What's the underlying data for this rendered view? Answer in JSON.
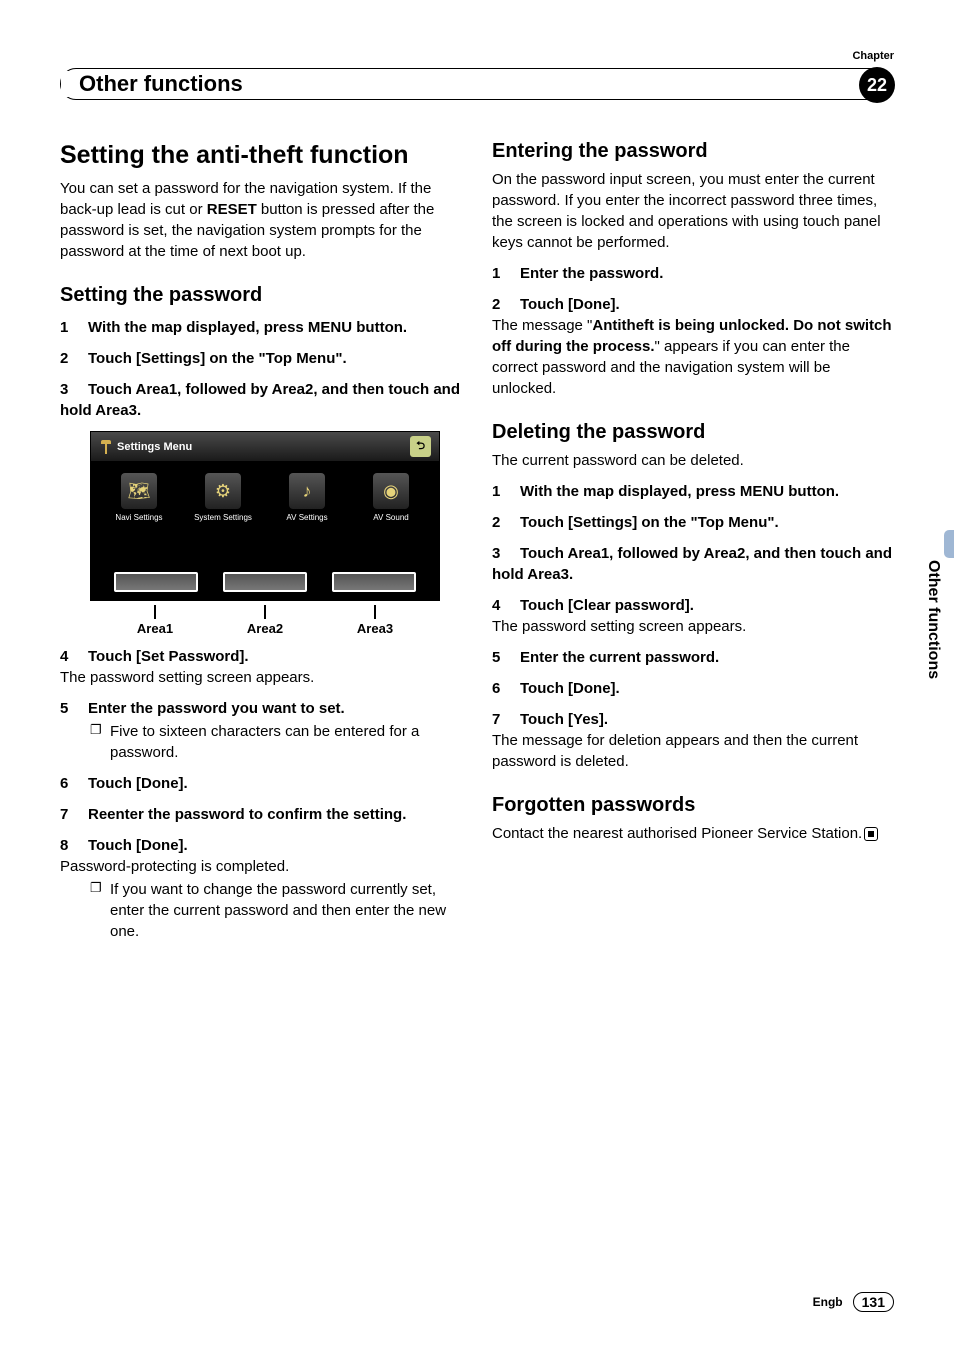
{
  "header": {
    "chapter_label": "Chapter",
    "title": "Other functions",
    "chapter_num": "22"
  },
  "side_tab": "Other functions",
  "footer": {
    "lang": "Engb",
    "page": "131"
  },
  "left": {
    "h1": "Setting the anti-theft function",
    "intro_pre": "You can set a password for the navigation system. If the back-up lead is cut or ",
    "intro_reset": "RESET",
    "intro_post": " button is pressed after the password is set, the navigation system prompts for the password at the time of next boot up.",
    "h2a": "Setting the password",
    "s1": {
      "n": "1",
      "t": "With the map displayed, press MENU button."
    },
    "s2": {
      "n": "2",
      "t": "Touch [Settings] on the \"Top Menu\"."
    },
    "s3": {
      "n": "3",
      "t": "Touch Area1, followed by Area2, and then touch and hold Area3."
    },
    "screen": {
      "title": "Settings Menu",
      "icons": [
        "Navi Settings",
        "System Settings",
        "AV Settings",
        "AV Sound"
      ],
      "areas": [
        "Area1",
        "Area2",
        "Area3"
      ]
    },
    "s4": {
      "n": "4",
      "t": "Touch [Set Password].",
      "f": "The password setting screen appears."
    },
    "s5": {
      "n": "5",
      "t": "Enter the password you want to set.",
      "b": "Five to sixteen characters can be entered for a password."
    },
    "s6": {
      "n": "6",
      "t": "Touch [Done]."
    },
    "s7": {
      "n": "7",
      "t": "Reenter the password to confirm the setting."
    },
    "s8": {
      "n": "8",
      "t": "Touch [Done].",
      "f": "Password-protecting is completed.",
      "b": "If you want to change the password currently set, enter the current password and then enter the new one."
    }
  },
  "right": {
    "h2a": "Entering the password",
    "p1": "On the password input screen, you must enter the current password. If you enter the incorrect password three times, the screen is locked and operations with using touch panel keys cannot be performed.",
    "e1": {
      "n": "1",
      "t": "Enter the password."
    },
    "e2": {
      "n": "2",
      "t": "Touch [Done]."
    },
    "e2_msg_pre": "The message \"",
    "e2_msg_bold": "Antitheft is being unlocked. Do not switch off during the process.",
    "e2_msg_post": "\" appears if you can enter the correct password and the navigation system will be unlocked.",
    "h2b": "Deleting the password",
    "p2": "The current password can be deleted.",
    "d1": {
      "n": "1",
      "t": "With the map displayed, press MENU button."
    },
    "d2": {
      "n": "2",
      "t": "Touch [Settings] on the \"Top Menu\"."
    },
    "d3": {
      "n": "3",
      "t": "Touch Area1, followed by Area2, and then touch and hold Area3."
    },
    "d4": {
      "n": "4",
      "t": "Touch [Clear password].",
      "f": "The password setting screen appears."
    },
    "d5": {
      "n": "5",
      "t": "Enter the current password."
    },
    "d6": {
      "n": "6",
      "t": "Touch [Done]."
    },
    "d7": {
      "n": "7",
      "t": "Touch [Yes].",
      "f": "The message for deletion appears and then the current password is deleted."
    },
    "h2c": "Forgotten passwords",
    "p3": "Contact the nearest authorised Pioneer Service Station."
  }
}
